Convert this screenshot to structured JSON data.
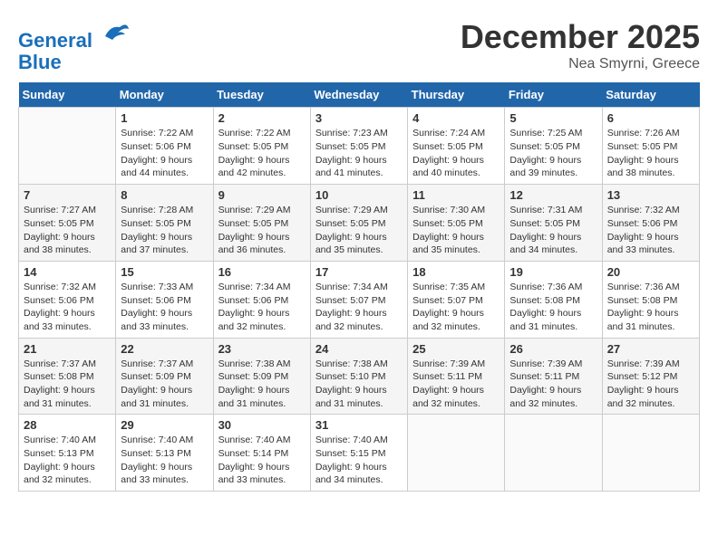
{
  "header": {
    "logo_line1": "General",
    "logo_line2": "Blue",
    "month": "December 2025",
    "location": "Nea Smyrni, Greece"
  },
  "weekdays": [
    "Sunday",
    "Monday",
    "Tuesday",
    "Wednesday",
    "Thursday",
    "Friday",
    "Saturday"
  ],
  "weeks": [
    [
      {
        "day": "",
        "info": ""
      },
      {
        "day": "1",
        "info": "Sunrise: 7:22 AM\nSunset: 5:06 PM\nDaylight: 9 hours\nand 44 minutes."
      },
      {
        "day": "2",
        "info": "Sunrise: 7:22 AM\nSunset: 5:05 PM\nDaylight: 9 hours\nand 42 minutes."
      },
      {
        "day": "3",
        "info": "Sunrise: 7:23 AM\nSunset: 5:05 PM\nDaylight: 9 hours\nand 41 minutes."
      },
      {
        "day": "4",
        "info": "Sunrise: 7:24 AM\nSunset: 5:05 PM\nDaylight: 9 hours\nand 40 minutes."
      },
      {
        "day": "5",
        "info": "Sunrise: 7:25 AM\nSunset: 5:05 PM\nDaylight: 9 hours\nand 39 minutes."
      },
      {
        "day": "6",
        "info": "Sunrise: 7:26 AM\nSunset: 5:05 PM\nDaylight: 9 hours\nand 38 minutes."
      }
    ],
    [
      {
        "day": "7",
        "info": "Sunrise: 7:27 AM\nSunset: 5:05 PM\nDaylight: 9 hours\nand 38 minutes."
      },
      {
        "day": "8",
        "info": "Sunrise: 7:28 AM\nSunset: 5:05 PM\nDaylight: 9 hours\nand 37 minutes."
      },
      {
        "day": "9",
        "info": "Sunrise: 7:29 AM\nSunset: 5:05 PM\nDaylight: 9 hours\nand 36 minutes."
      },
      {
        "day": "10",
        "info": "Sunrise: 7:29 AM\nSunset: 5:05 PM\nDaylight: 9 hours\nand 35 minutes."
      },
      {
        "day": "11",
        "info": "Sunrise: 7:30 AM\nSunset: 5:05 PM\nDaylight: 9 hours\nand 35 minutes."
      },
      {
        "day": "12",
        "info": "Sunrise: 7:31 AM\nSunset: 5:05 PM\nDaylight: 9 hours\nand 34 minutes."
      },
      {
        "day": "13",
        "info": "Sunrise: 7:32 AM\nSunset: 5:06 PM\nDaylight: 9 hours\nand 33 minutes."
      }
    ],
    [
      {
        "day": "14",
        "info": "Sunrise: 7:32 AM\nSunset: 5:06 PM\nDaylight: 9 hours\nand 33 minutes."
      },
      {
        "day": "15",
        "info": "Sunrise: 7:33 AM\nSunset: 5:06 PM\nDaylight: 9 hours\nand 33 minutes."
      },
      {
        "day": "16",
        "info": "Sunrise: 7:34 AM\nSunset: 5:06 PM\nDaylight: 9 hours\nand 32 minutes."
      },
      {
        "day": "17",
        "info": "Sunrise: 7:34 AM\nSunset: 5:07 PM\nDaylight: 9 hours\nand 32 minutes."
      },
      {
        "day": "18",
        "info": "Sunrise: 7:35 AM\nSunset: 5:07 PM\nDaylight: 9 hours\nand 32 minutes."
      },
      {
        "day": "19",
        "info": "Sunrise: 7:36 AM\nSunset: 5:08 PM\nDaylight: 9 hours\nand 31 minutes."
      },
      {
        "day": "20",
        "info": "Sunrise: 7:36 AM\nSunset: 5:08 PM\nDaylight: 9 hours\nand 31 minutes."
      }
    ],
    [
      {
        "day": "21",
        "info": "Sunrise: 7:37 AM\nSunset: 5:08 PM\nDaylight: 9 hours\nand 31 minutes."
      },
      {
        "day": "22",
        "info": "Sunrise: 7:37 AM\nSunset: 5:09 PM\nDaylight: 9 hours\nand 31 minutes."
      },
      {
        "day": "23",
        "info": "Sunrise: 7:38 AM\nSunset: 5:09 PM\nDaylight: 9 hours\nand 31 minutes."
      },
      {
        "day": "24",
        "info": "Sunrise: 7:38 AM\nSunset: 5:10 PM\nDaylight: 9 hours\nand 31 minutes."
      },
      {
        "day": "25",
        "info": "Sunrise: 7:39 AM\nSunset: 5:11 PM\nDaylight: 9 hours\nand 32 minutes."
      },
      {
        "day": "26",
        "info": "Sunrise: 7:39 AM\nSunset: 5:11 PM\nDaylight: 9 hours\nand 32 minutes."
      },
      {
        "day": "27",
        "info": "Sunrise: 7:39 AM\nSunset: 5:12 PM\nDaylight: 9 hours\nand 32 minutes."
      }
    ],
    [
      {
        "day": "28",
        "info": "Sunrise: 7:40 AM\nSunset: 5:13 PM\nDaylight: 9 hours\nand 32 minutes."
      },
      {
        "day": "29",
        "info": "Sunrise: 7:40 AM\nSunset: 5:13 PM\nDaylight: 9 hours\nand 33 minutes."
      },
      {
        "day": "30",
        "info": "Sunrise: 7:40 AM\nSunset: 5:14 PM\nDaylight: 9 hours\nand 33 minutes."
      },
      {
        "day": "31",
        "info": "Sunrise: 7:40 AM\nSunset: 5:15 PM\nDaylight: 9 hours\nand 34 minutes."
      },
      {
        "day": "",
        "info": ""
      },
      {
        "day": "",
        "info": ""
      },
      {
        "day": "",
        "info": ""
      }
    ]
  ]
}
